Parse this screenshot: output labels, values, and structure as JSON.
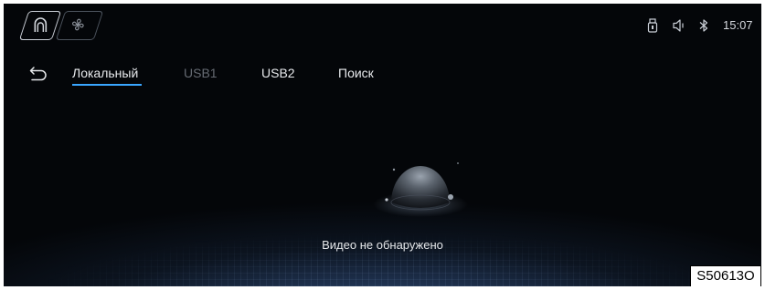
{
  "status_bar": {
    "clock": "15:07",
    "icons": [
      "home-headrest-icon",
      "fan-icon",
      "usb-drive-icon",
      "volume-icon",
      "bluetooth-icon"
    ]
  },
  "nav": {
    "back_icon": "back-arrow-icon",
    "tabs": [
      {
        "label": "Локальный",
        "active": true
      },
      {
        "label": "USB1",
        "active": false
      },
      {
        "label": "USB2",
        "active": false
      },
      {
        "label": "Поиск",
        "active": false
      }
    ]
  },
  "empty_state": {
    "icon": "planet-icon",
    "message": "Видео не обнаружено"
  },
  "figure_code": "S50613O",
  "colors": {
    "accent": "#3aa6ff",
    "background": "#05080c",
    "text": "#e8eaed",
    "inactive_text": "#666b73"
  }
}
